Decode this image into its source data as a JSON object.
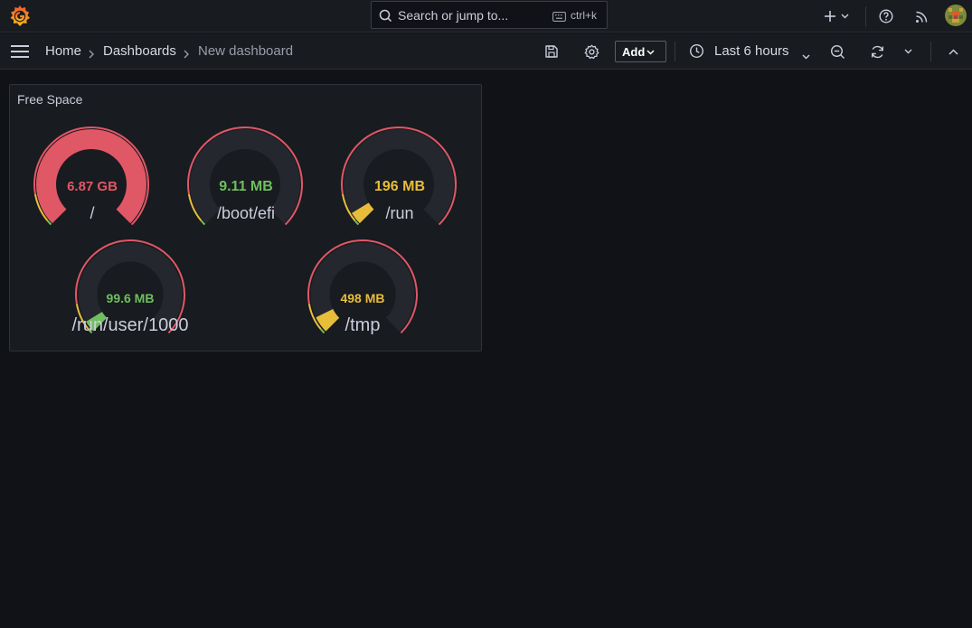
{
  "topbar": {
    "search_placeholder": "Search or jump to...",
    "search_shortcut": "ctrl+k",
    "icons": [
      "grafana-logo-icon",
      "search-icon",
      "keyboard-icon",
      "plus-icon",
      "chevron-down-icon",
      "help-icon",
      "rss-icon",
      "avatar"
    ]
  },
  "breadcrumb": {
    "items": [
      "Home",
      "Dashboards",
      "New dashboard"
    ]
  },
  "toolbar": {
    "add_label": "Add",
    "time_range": "Last 6 hours",
    "icons": [
      "save-icon",
      "gear-icon",
      "clock-icon",
      "zoom-out-icon",
      "refresh-icon",
      "chevron-down-icon",
      "chevron-up-icon"
    ]
  },
  "panel": {
    "title": "Free Space",
    "gauges": [
      {
        "name": "/",
        "value_label": "6.87 GB",
        "fill": 1.0,
        "color": "#e05766"
      },
      {
        "name": "/boot/efi",
        "value_label": "9.11 MB",
        "fill": 0.0,
        "color": "#6fbf5f"
      },
      {
        "name": "/run",
        "value_label": "196 MB",
        "fill": 0.05,
        "color": "#e8bd3a"
      },
      {
        "name": "/run/user/1000",
        "value_label": "99.6 MB",
        "fill": 0.05,
        "color": "#6fbf5f"
      },
      {
        "name": "/tmp",
        "value_label": "498 MB",
        "fill": 0.07,
        "color": "#e8bd3a"
      }
    ],
    "threshold_colors": {
      "base": "#6fbf5f",
      "warn": "#e8bd3a",
      "crit": "#e05766"
    }
  }
}
